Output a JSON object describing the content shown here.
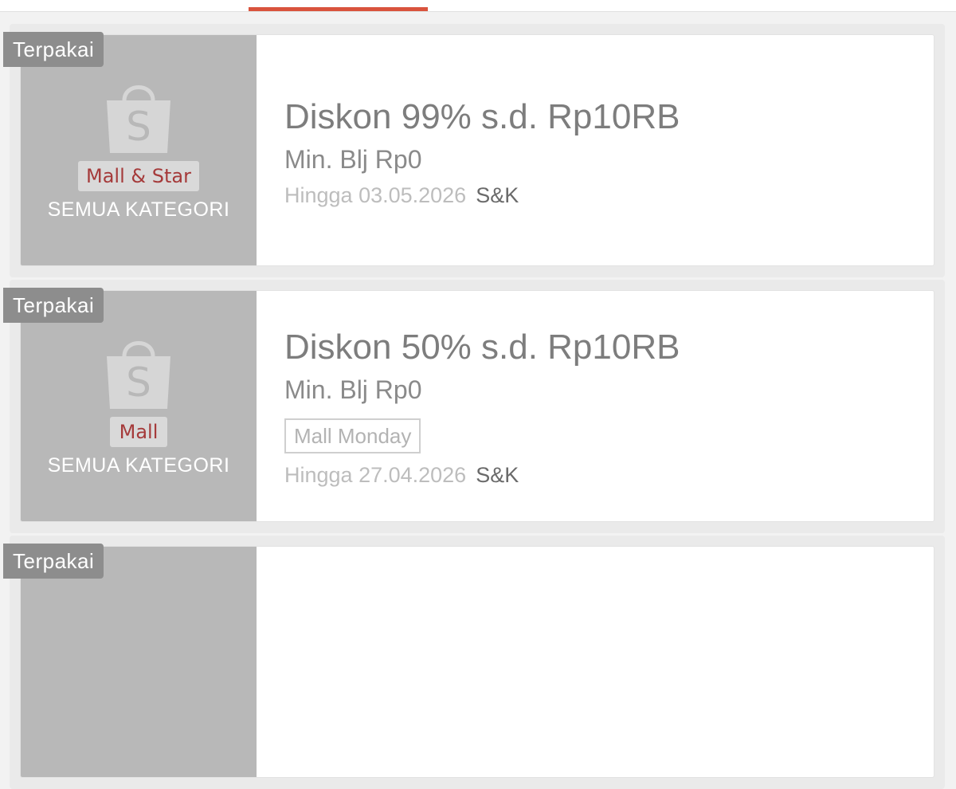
{
  "header": {
    "active_tab_color": "#d9533d"
  },
  "vouchers": [
    {
      "status_badge": "Terpakai",
      "store_tag": "Mall & Star",
      "category": "SEMUA KATEGORI",
      "title": "Diskon 99% s.d. Rp10RB",
      "min_buy": "Min. Blj Rp0",
      "label": "",
      "expiry": "Hingga 03.05.2026",
      "terms_link": "S&K",
      "icon": "shopee-bag-icon"
    },
    {
      "status_badge": "Terpakai",
      "store_tag": "Mall",
      "category": "SEMUA KATEGORI",
      "title": "Diskon 50% s.d. Rp10RB",
      "min_buy": "Min. Blj Rp0",
      "label": "Mall Monday",
      "expiry": "Hingga 27.04.2026",
      "terms_link": "S&K",
      "icon": "shopee-bag-icon"
    },
    {
      "status_badge": "Terpakai"
    }
  ]
}
